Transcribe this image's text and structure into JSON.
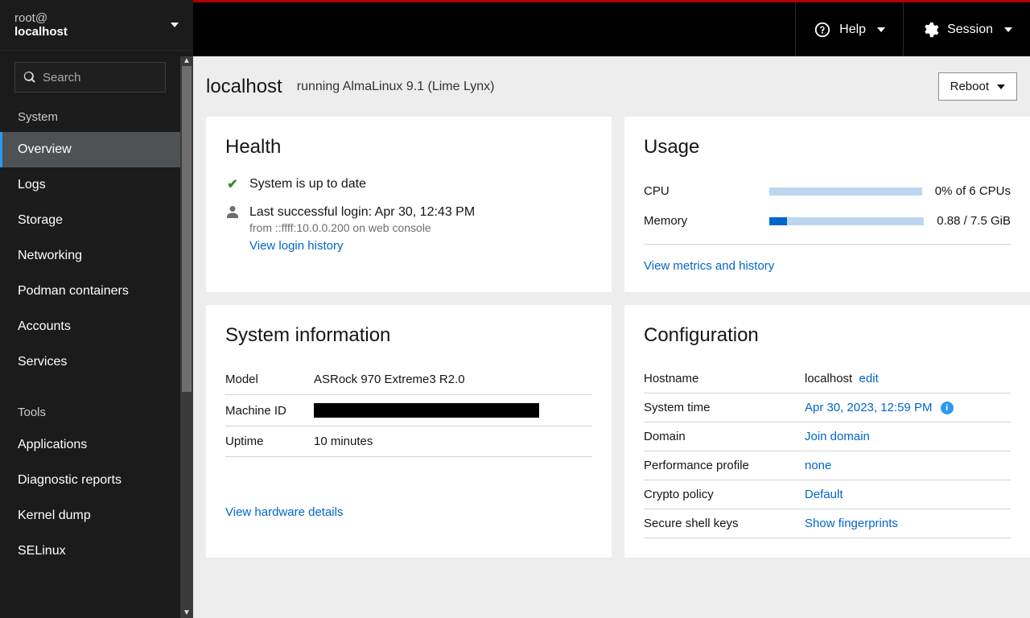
{
  "host_switcher": {
    "user": "root@",
    "host": "localhost"
  },
  "search": {
    "placeholder": "Search"
  },
  "nav": {
    "section_system": "System",
    "items_system": [
      {
        "id": "overview",
        "label": "Overview",
        "active": true
      },
      {
        "id": "logs",
        "label": "Logs",
        "active": false
      },
      {
        "id": "storage",
        "label": "Storage",
        "active": false
      },
      {
        "id": "networking",
        "label": "Networking",
        "active": false
      },
      {
        "id": "podman",
        "label": "Podman containers",
        "active": false
      },
      {
        "id": "accounts",
        "label": "Accounts",
        "active": false
      },
      {
        "id": "services",
        "label": "Services",
        "active": false
      }
    ],
    "section_tools": "Tools",
    "items_tools": [
      {
        "id": "applications",
        "label": "Applications",
        "active": false
      },
      {
        "id": "diagnostic",
        "label": "Diagnostic reports",
        "active": false
      },
      {
        "id": "kernel-dump",
        "label": "Kernel dump",
        "active": false
      },
      {
        "id": "selinux",
        "label": "SELinux",
        "active": false
      }
    ]
  },
  "topbar": {
    "help": "Help",
    "session": "Session"
  },
  "page": {
    "title": "localhost",
    "subtitle": "running AlmaLinux 9.1 (Lime Lynx)",
    "reboot": "Reboot"
  },
  "health": {
    "heading": "Health",
    "status": "System is up to date",
    "last_login_label": "Last successful login: Apr 30, 12:43 PM",
    "last_login_from": "from ::ffff:10.0.0.200 on web console",
    "view_login_history": "View login history"
  },
  "usage": {
    "heading": "Usage",
    "cpu_label": "CPU",
    "cpu_text": "0% of 6 CPUs",
    "cpu_fill_pct": 0,
    "mem_label": "Memory",
    "mem_text": "0.88 / 7.5 GiB",
    "mem_fill_pct": 11.7,
    "view_metrics": "View metrics and history"
  },
  "sysinfo": {
    "heading": "System information",
    "model_label": "Model",
    "model_value": "ASRock 970 Extreme3 R2.0",
    "machine_id_label": "Machine ID",
    "uptime_label": "Uptime",
    "uptime_value": "10 minutes",
    "view_hardware": "View hardware details"
  },
  "config": {
    "heading": "Configuration",
    "hostname_label": "Hostname",
    "hostname_value": "localhost",
    "hostname_edit": "edit",
    "systime_label": "System time",
    "systime_value": "Apr 30, 2023, 12:59 PM",
    "domain_label": "Domain",
    "domain_value": "Join domain",
    "perf_label": "Performance profile",
    "perf_value": "none",
    "crypto_label": "Crypto policy",
    "crypto_value": "Default",
    "ssh_label": "Secure shell keys",
    "ssh_value": "Show fingerprints"
  }
}
